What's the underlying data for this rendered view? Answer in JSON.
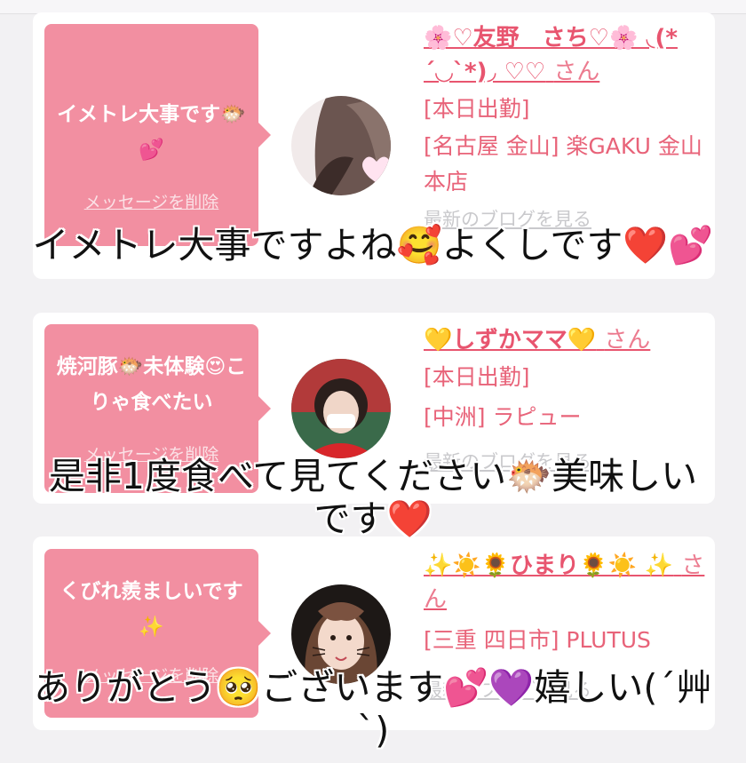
{
  "cards": [
    {
      "message": "イメトレ大事です🐡💕",
      "delete_label": "メッセージを削除",
      "name": "🌸♡友野　さち♡🌸 ◟(*´◡`*)◞ ♡♡",
      "san": "さん",
      "lines": [
        "[本日出勤]",
        "[名古屋 金山] 楽GAKU 金山本店"
      ],
      "blog_label": "最新のブログを見る",
      "avatar_icon": "woman-hair-heart-avatar",
      "caption": "イメトレ大事ですよね🥰よくしです❤️💕"
    },
    {
      "message": "焼河豚🐡未体験😍こりゃ食べたい",
      "delete_label": "メッセージを削除",
      "name": "💛しずかママ💛",
      "san": "さん",
      "lines": [
        "[本日出勤]",
        "[中洲] ラピュー"
      ],
      "blog_label": "最新のブログを見る",
      "avatar_icon": "woman-stadium-avatar",
      "caption": "是非1度食べて見てください🐡美味しい\nです❤️"
    },
    {
      "message": "くびれ羨ましいです✨",
      "delete_label": "メッセージを削除",
      "name": "✨☀️🌻ひまり🌻☀️ ✨",
      "san": "さん",
      "lines": [
        "[三重 四日市] PLUTUS"
      ],
      "blog_label": "最新のブログを見る",
      "avatar_icon": "woman-cat-filter-avatar",
      "caption": "ありがとう🥺ございます💕💜嬉しい(´艸\n`)"
    }
  ],
  "colors": {
    "bubble": "#f28fa1",
    "accent": "#e8556f",
    "background": "#f2f1f3"
  }
}
